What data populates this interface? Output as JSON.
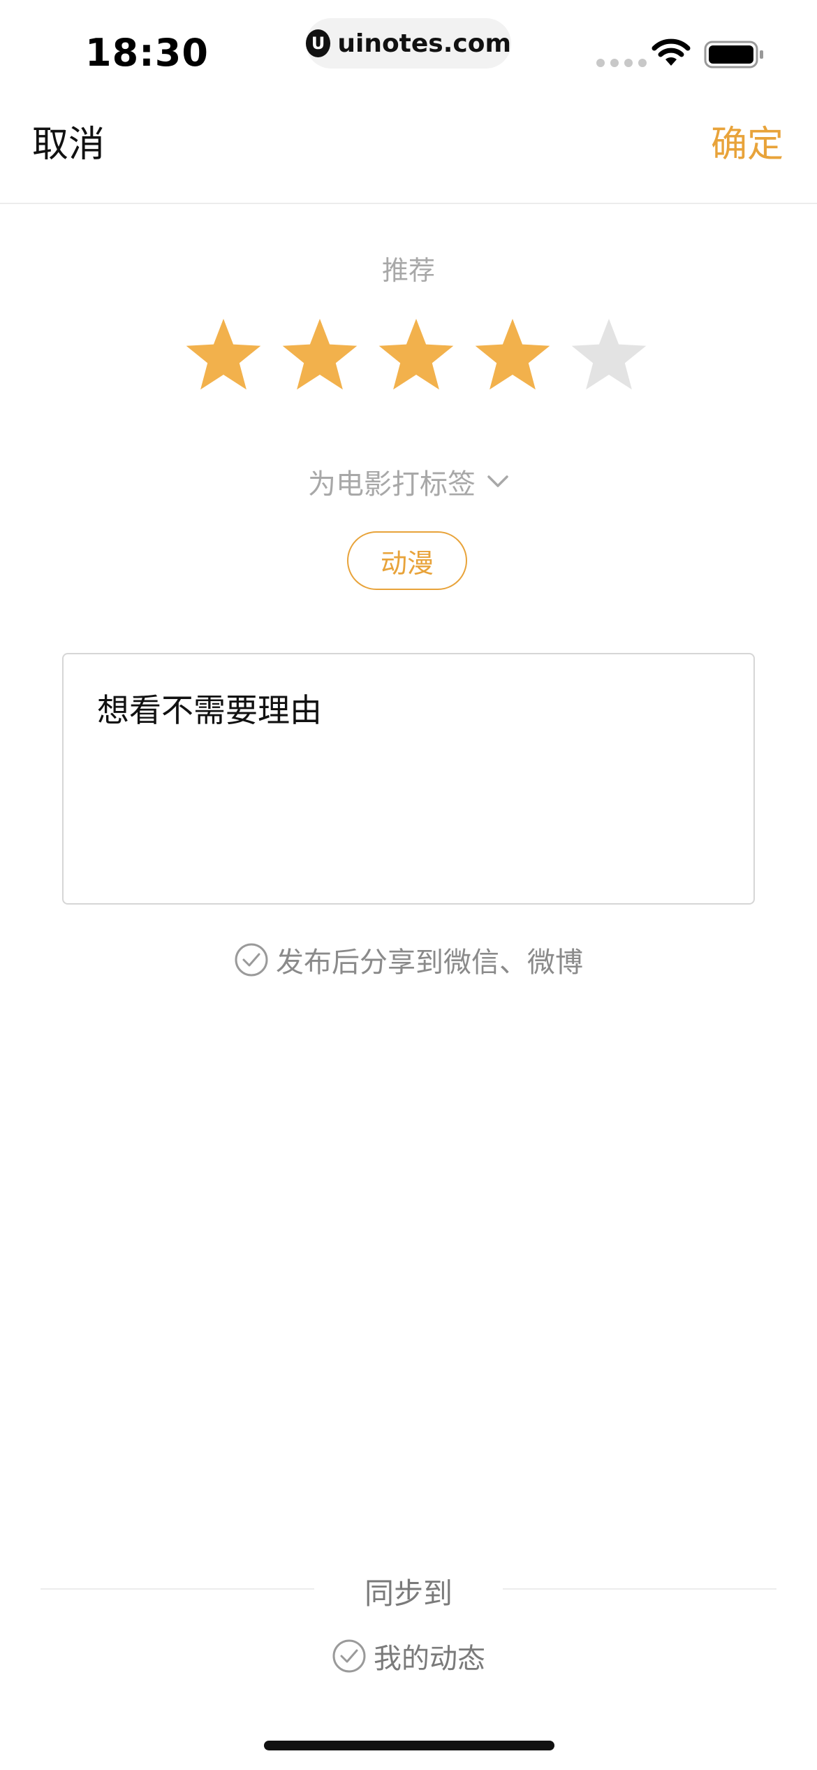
{
  "status_bar": {
    "time": "18:30",
    "url": "uinotes.com",
    "logo_letter": "U",
    "icons": [
      "signal-dots-icon",
      "wifi-icon",
      "battery-icon"
    ]
  },
  "nav": {
    "cancel_label": "取消",
    "confirm_label": "确定"
  },
  "rating": {
    "label": "推荐",
    "value": 4,
    "max": 5,
    "filled_color": "#F2B14C",
    "empty_color": "#E3E3E3"
  },
  "tags": {
    "header": "为电影打标签",
    "selected": [
      "动漫"
    ],
    "accent_color": "#E8A33A"
  },
  "comment": {
    "text": "想看不需要理由"
  },
  "share": {
    "label": "发布后分享到微信、微博"
  },
  "sync": {
    "label": "同步到",
    "option_label": "我的动态"
  }
}
